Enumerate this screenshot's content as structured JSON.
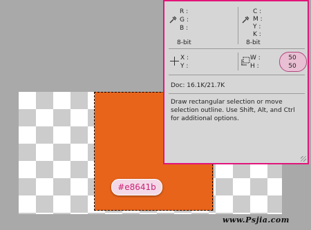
{
  "canvas": {
    "color_hex": "#e8641b",
    "hex_label": "#e8641b"
  },
  "info_panel": {
    "left_color": {
      "labels": [
        "R :",
        "G :",
        "B :"
      ],
      "mode": "8-bit"
    },
    "right_color": {
      "labels": [
        "C :",
        "M :",
        "Y :",
        "K :"
      ],
      "mode": "8-bit"
    },
    "position": {
      "x_label": "X :",
      "y_label": "Y :"
    },
    "size": {
      "w_label": "W :",
      "h_label": "H :",
      "w_value": "50",
      "h_value": "50"
    },
    "doc": "Doc: 16.1K/21.7K",
    "hint_lines": [
      "Draw rectangular selection or move",
      "selection outline.  Use Shift, Alt, and Ctrl",
      "for additional options."
    ]
  },
  "watermark": "www.Psjia.com",
  "colors": {
    "accent_border": "#e2147a",
    "label_text": "#cc2277"
  }
}
